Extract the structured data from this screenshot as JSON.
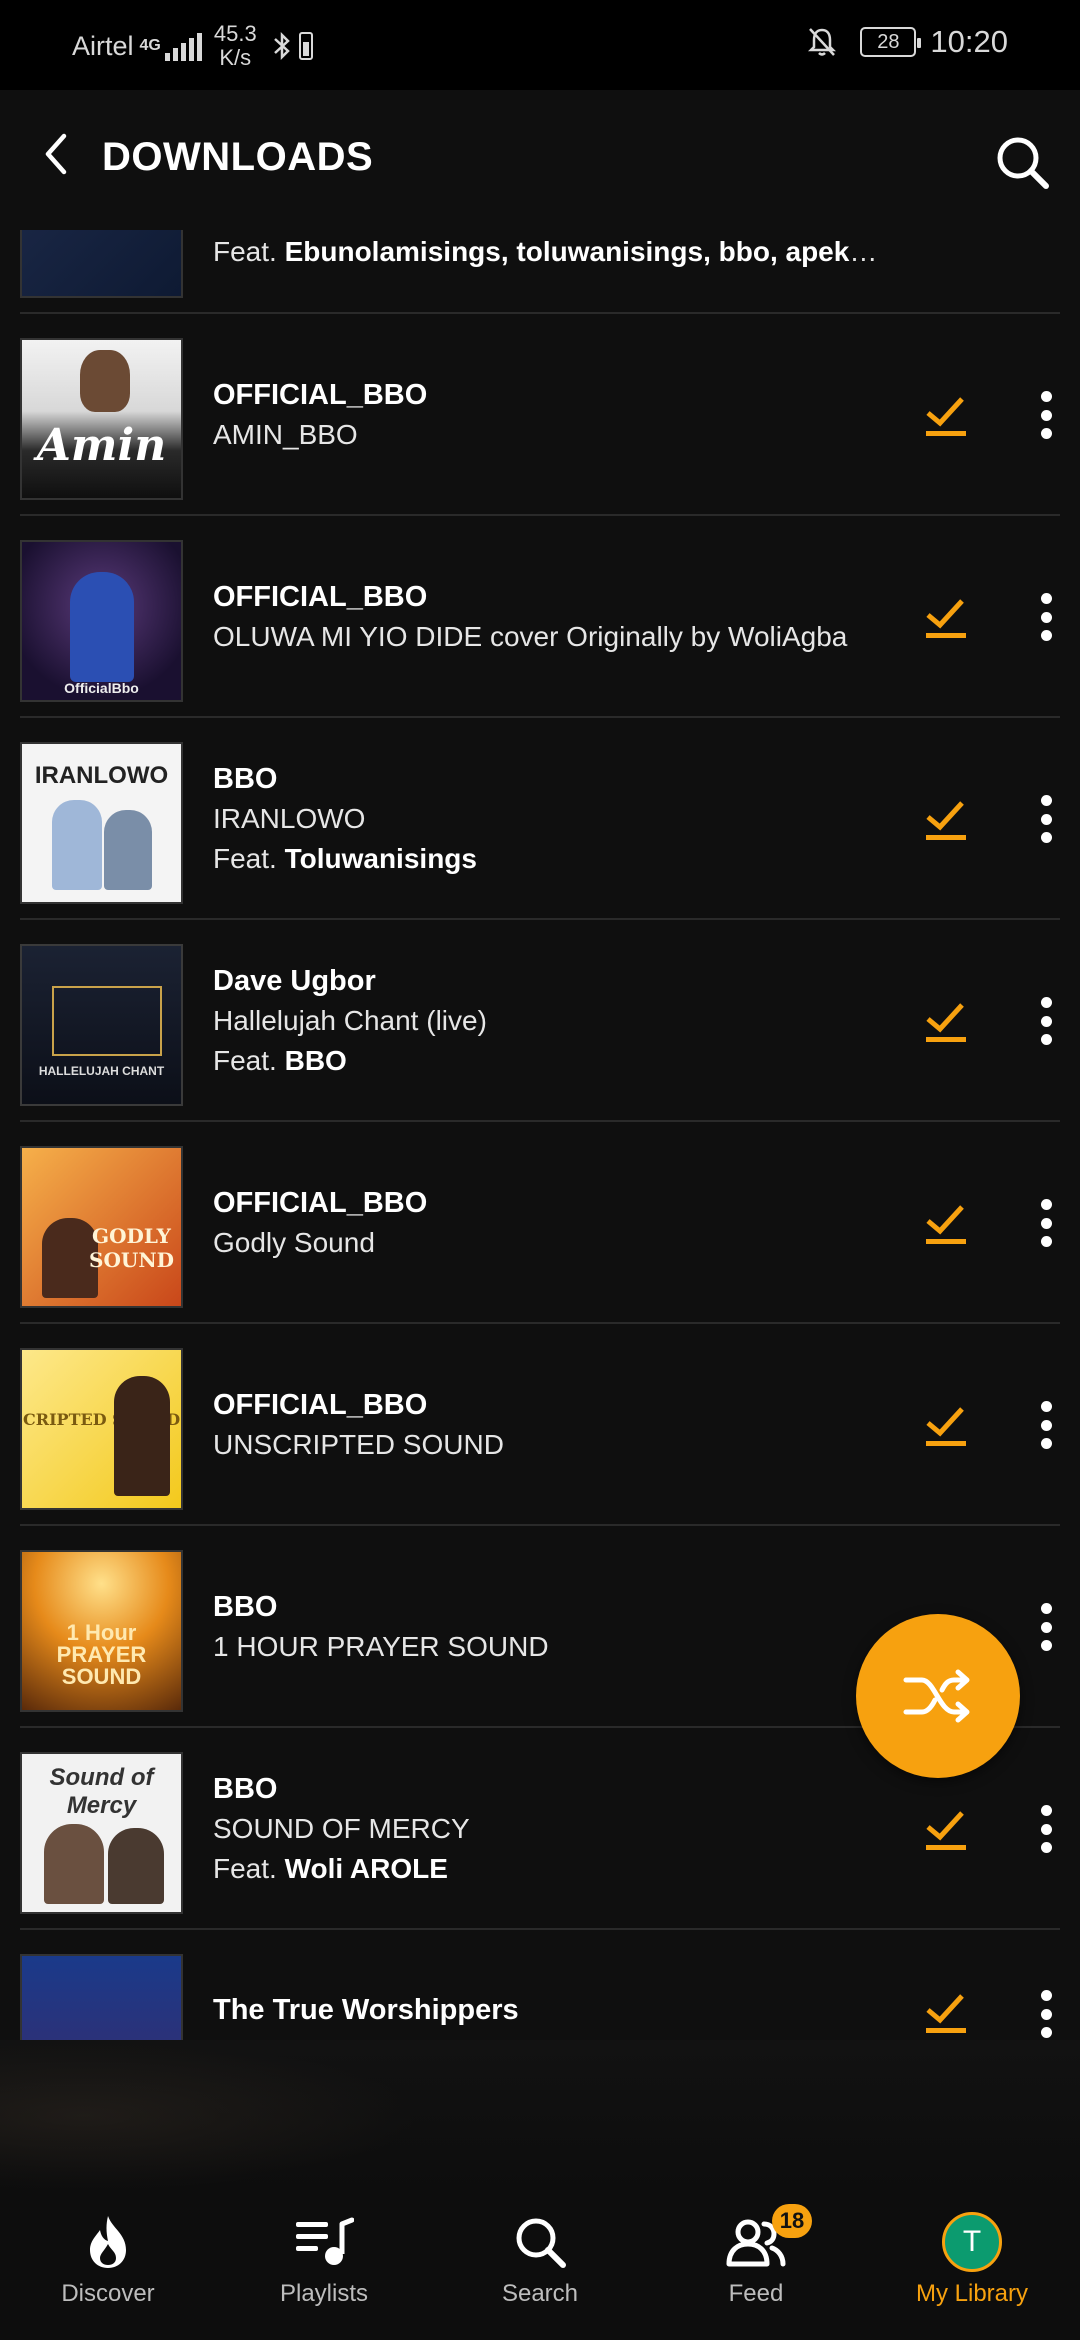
{
  "status_bar": {
    "carrier": "Airtel",
    "network": "4G",
    "speed_value": "45.3",
    "speed_unit": "K/s",
    "battery_level": "28",
    "time": "10:20"
  },
  "header": {
    "title": "DOWNLOADS"
  },
  "rows": [
    {
      "artist": "",
      "song": "",
      "feat_prefix": "Feat. ",
      "feat": "Ebunolamisings, toluwanisings, bbo, apekeola,..."
    },
    {
      "artist": "OFFICIAL_BBO",
      "song": "AMIN_BBO",
      "feat_prefix": "",
      "feat": "",
      "thumb_text": "Amin"
    },
    {
      "artist": "OFFICIAL_BBO",
      "song": "OLUWA MI YIO DIDE cover Originally by WoliAgba",
      "feat_prefix": "",
      "feat": "",
      "thumb_text": "OfficialBbo"
    },
    {
      "artist": "BBO",
      "song": "IRANLOWO",
      "feat_prefix": "Feat. ",
      "feat": "Toluwanisings",
      "thumb_text": "IRANLOWO"
    },
    {
      "artist": "Dave Ugbor",
      "song": "Hallelujah Chant (live)",
      "feat_prefix": "Feat. ",
      "feat": "BBO",
      "thumb_text": "HALLELUJAH CHANT"
    },
    {
      "artist": "OFFICIAL_BBO",
      "song": "Godly Sound",
      "feat_prefix": "",
      "feat": "",
      "thumb_text": "GODLY SOUND"
    },
    {
      "artist": "OFFICIAL_BBO",
      "song": "UNSCRIPTED SOUND",
      "feat_prefix": "",
      "feat": "",
      "thumb_text": "UNSCRIPTED SOUND"
    },
    {
      "artist": "BBO",
      "song": "1 HOUR PRAYER SOUND",
      "feat_prefix": "",
      "feat": "",
      "thumb_text": "1 Hour PRAYER SOUND"
    },
    {
      "artist": "BBO",
      "song": "SOUND OF MERCY",
      "feat_prefix": "Feat. ",
      "feat": "Woli AROLE",
      "thumb_text": "Sound of Mercy"
    },
    {
      "artist": "The True Worshippers",
      "song": "",
      "feat_prefix": "",
      "feat": ""
    }
  ],
  "nav": {
    "discover": "Discover",
    "playlists": "Playlists",
    "search": "Search",
    "feed": "Feed",
    "feed_badge": "18",
    "library": "My Library",
    "avatar_initial": "T"
  },
  "colors": {
    "accent": "#f7a10f",
    "background": "#0f0f0f",
    "avatar": "#0c9b6f"
  }
}
